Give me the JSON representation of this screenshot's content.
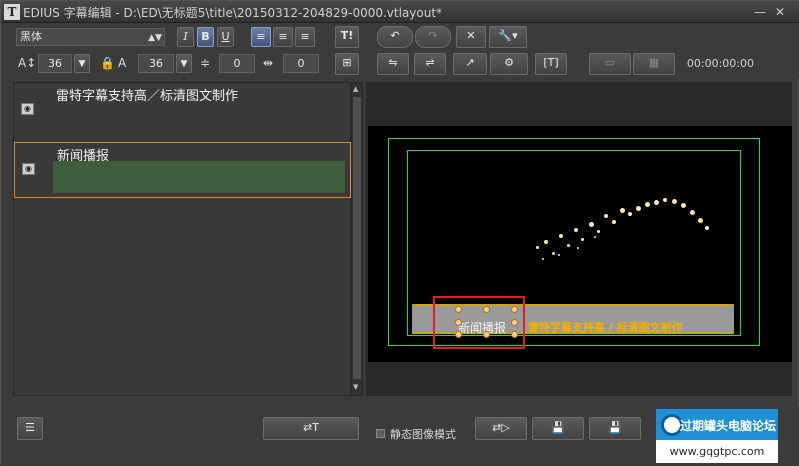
{
  "window": {
    "title": "EDIUS 字幕编辑 - D:\\ED\\无标题5\\title\\20150312-204829-0000.vtlayout*",
    "app_icon": "T",
    "minimize": "—",
    "close": "✕"
  },
  "toolbar": {
    "font_name": "黑体",
    "italic": "I",
    "bold": "B",
    "underline": "U",
    "font_size": "36",
    "font_size2": "36",
    "line_spacing": "0",
    "char_spacing": "0",
    "timecode": "00:00:00:00"
  },
  "layers": [
    {
      "text": "雷特字幕支持高／标清图文制作",
      "selected": false
    },
    {
      "text": "新闻播报",
      "selected": true
    }
  ],
  "preview": {
    "caption_text": "雷特字幕支持高 / 标清图文制作",
    "news_text": "新闻播报"
  },
  "bottom": {
    "static_mode_label": "静态图像模式"
  },
  "watermark": {
    "title": "过期罐头电脑论坛",
    "url": "www.gqgtpc.com"
  },
  "colors": {
    "selection_outline": "#e08a2a",
    "safe_area": "#2bdc2b",
    "caption_text": "#f0b000",
    "layer_highlight": "#3f5d3c"
  }
}
